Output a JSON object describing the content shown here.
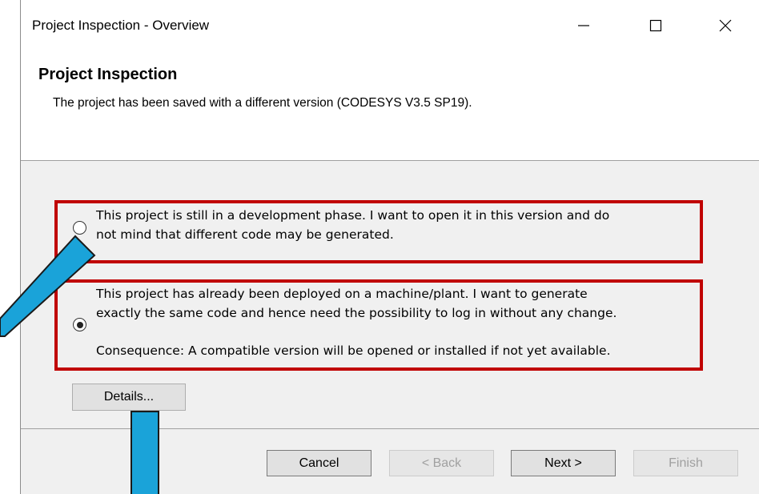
{
  "window": {
    "title": "Project Inspection - Overview",
    "minimize_icon": "minimize-icon",
    "maximize_icon": "maximize-icon",
    "close_icon": "close-icon"
  },
  "header": {
    "title": "Project Inspection",
    "subtitle": "The project has been saved with a different version (CODESYS V3.5 SP19)."
  },
  "options": [
    {
      "line1": "This project is still in a development phase. I want to open it in this version and do",
      "line2": "not mind that different code may be generated.",
      "selected": false
    },
    {
      "line1": "This project has already been deployed on a machine/plant. I want to generate",
      "line2": "exactly the same code and hence need the possibility to log in without any change.",
      "line3": "Consequence: A compatible version will be opened or installed if not yet available.",
      "selected": true
    }
  ],
  "buttons": {
    "details": "Details...",
    "cancel": "Cancel",
    "back": "< Back",
    "next": "Next >",
    "finish": "Finish"
  },
  "colors": {
    "highlight_border": "#c00000",
    "annotation_arrow": "#1aa3d9"
  }
}
